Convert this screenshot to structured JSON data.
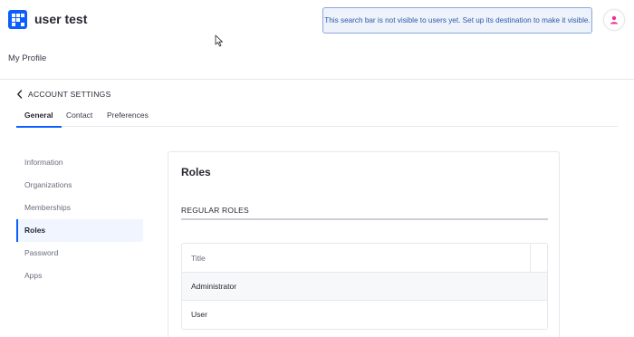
{
  "header": {
    "site_title": "user test",
    "search_notice": "This search bar is not visible to users yet. Set up its destination to make it visible.",
    "profile_link": "My Profile"
  },
  "account": {
    "back_label": "ACCOUNT SETTINGS",
    "tabs": [
      {
        "label": "General",
        "active": true
      },
      {
        "label": "Contact",
        "active": false
      },
      {
        "label": "Preferences",
        "active": false
      }
    ]
  },
  "sidebar": {
    "items": [
      {
        "label": "Information",
        "active": false
      },
      {
        "label": "Organizations",
        "active": false
      },
      {
        "label": "Memberships",
        "active": false
      },
      {
        "label": "Roles",
        "active": true
      },
      {
        "label": "Password",
        "active": false
      },
      {
        "label": "Apps",
        "active": false
      }
    ]
  },
  "roles": {
    "title": "Roles",
    "section_label": "REGULAR ROLES",
    "table": {
      "columns": [
        "Title"
      ],
      "rows": [
        "Administrator",
        "User"
      ]
    }
  },
  "colors": {
    "accent": "#0b5fff",
    "avatar_icon": "#e9338f",
    "notice_bg": "#eef2fa",
    "notice_border": "#89a7e0",
    "notice_text": "#2e5aac"
  },
  "icons": {
    "logo": "grid-logo-icon",
    "avatar": "user-icon",
    "back": "chevron-left-icon",
    "cursor": "mouse-pointer-icon"
  }
}
